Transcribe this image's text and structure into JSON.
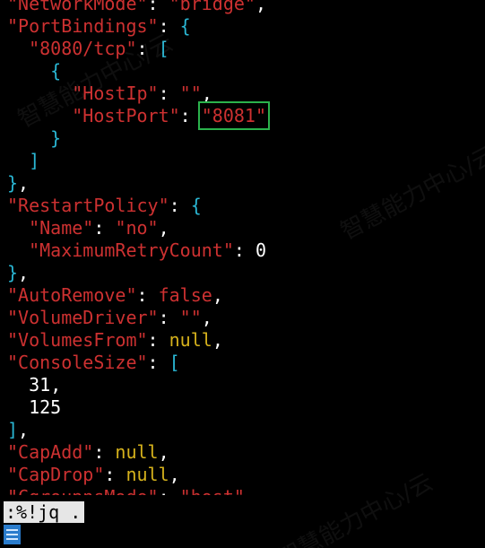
{
  "terminal": {
    "lines": [
      [
        [
          "k",
          "\"NetworkMode\""
        ],
        [
          "p",
          ": "
        ],
        [
          "k",
          "\"bridge\""
        ],
        [
          "p",
          ","
        ]
      ],
      [
        [
          "k",
          "\"PortBindings\""
        ],
        [
          "p",
          ": "
        ],
        [
          "b",
          "{"
        ]
      ],
      [
        [
          "p",
          "  "
        ],
        [
          "k",
          "\"8080/tcp\""
        ],
        [
          "p",
          ": "
        ],
        [
          "b",
          "["
        ]
      ],
      [
        [
          "p",
          "    "
        ],
        [
          "b",
          "{"
        ]
      ],
      [
        [
          "p",
          "      "
        ],
        [
          "k",
          "\"HostIp\""
        ],
        [
          "p",
          ": "
        ],
        [
          "k",
          "\"\""
        ],
        [
          "p",
          ","
        ]
      ],
      [
        [
          "p",
          "      "
        ],
        [
          "k",
          "\"HostPort\""
        ],
        [
          "p",
          ": "
        ],
        [
          "k",
          "\"8081\"",
          "hl"
        ]
      ],
      [
        [
          "p",
          "    "
        ],
        [
          "b",
          "}"
        ]
      ],
      [
        [
          "p",
          "  "
        ],
        [
          "b",
          "]"
        ]
      ],
      [
        [
          "b",
          "}"
        ],
        [
          "p",
          ","
        ]
      ],
      [
        [
          "k",
          "\"RestartPolicy\""
        ],
        [
          "p",
          ": "
        ],
        [
          "b",
          "{"
        ]
      ],
      [
        [
          "p",
          "  "
        ],
        [
          "k",
          "\"Name\""
        ],
        [
          "p",
          ": "
        ],
        [
          "k",
          "\"no\""
        ],
        [
          "p",
          ","
        ]
      ],
      [
        [
          "p",
          "  "
        ],
        [
          "k",
          "\"MaximumRetryCount\""
        ],
        [
          "p",
          ": "
        ],
        [
          "num",
          "0"
        ]
      ],
      [
        [
          "b",
          "}"
        ],
        [
          "p",
          ","
        ]
      ],
      [
        [
          "k",
          "\"AutoRemove\""
        ],
        [
          "p",
          ": "
        ],
        [
          "f",
          "false"
        ],
        [
          "p",
          ","
        ]
      ],
      [
        [
          "k",
          "\"VolumeDriver\""
        ],
        [
          "p",
          ": "
        ],
        [
          "k",
          "\"\""
        ],
        [
          "p",
          ","
        ]
      ],
      [
        [
          "k",
          "\"VolumesFrom\""
        ],
        [
          "p",
          ": "
        ],
        [
          "n",
          "null"
        ],
        [
          "p",
          ","
        ]
      ],
      [
        [
          "k",
          "\"ConsoleSize\""
        ],
        [
          "p",
          ": "
        ],
        [
          "b",
          "["
        ]
      ],
      [
        [
          "p",
          "  "
        ],
        [
          "num",
          "31"
        ],
        [
          "p",
          ","
        ]
      ],
      [
        [
          "p",
          "  "
        ],
        [
          "num",
          "125"
        ]
      ],
      [
        [
          "b",
          "]"
        ],
        [
          "p",
          ","
        ]
      ],
      [
        [
          "k",
          "\"CapAdd\""
        ],
        [
          "p",
          ": "
        ],
        [
          "n",
          "null"
        ],
        [
          "p",
          ","
        ]
      ],
      [
        [
          "k",
          "\"CapDrop\""
        ],
        [
          "p",
          ": "
        ],
        [
          "n",
          "null"
        ],
        [
          "p",
          ","
        ]
      ],
      [
        [
          "k",
          "\"CgroupnsMode\""
        ],
        [
          "p",
          ": "
        ],
        [
          "k",
          "\"host\""
        ],
        [
          "p",
          ","
        ]
      ]
    ]
  },
  "command_line": {
    "text": ":%!jq ."
  },
  "watermark": {
    "text": "智慧能力中心/云"
  },
  "colors": {
    "background": "#000000",
    "key": "#cd3131",
    "bracket": "#2ab7d4",
    "null": "#d6b21c",
    "highlight_box": "#2bb24c",
    "cursor": "#2a7ccc"
  }
}
